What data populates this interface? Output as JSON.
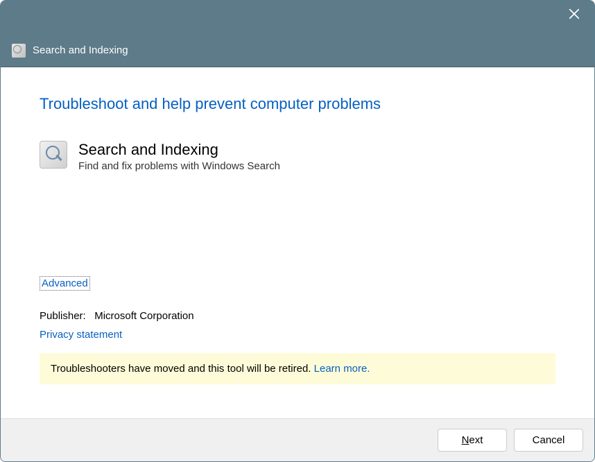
{
  "titlebar": {
    "title": "Search and Indexing"
  },
  "content": {
    "heading": "Troubleshoot and help prevent computer problems",
    "appTitle": "Search and Indexing",
    "appDesc": "Find and fix problems with Windows Search",
    "advancedLink": "Advanced",
    "publisherLabel": "Publisher:",
    "publisherValue": "Microsoft Corporation",
    "privacyLink": "Privacy statement",
    "warningText": "Troubleshooters have moved and this tool will be retired. ",
    "learnMore": "Learn more."
  },
  "footer": {
    "nextPrefix": "N",
    "nextRest": "ext",
    "cancel": "Cancel"
  }
}
